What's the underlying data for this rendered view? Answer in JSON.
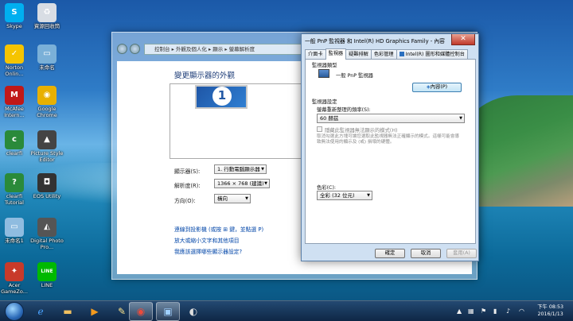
{
  "desktop": {
    "icons": [
      {
        "label": "Skype",
        "icon": "skype-icon",
        "color": "#00aff0",
        "glyph": "S"
      },
      {
        "label": "資源回收筒",
        "icon": "recycle-bin-icon",
        "color": "#d8dde4",
        "glyph": "♻"
      },
      {
        "label": "Norton Onlin...",
        "icon": "norton-icon",
        "color": "#f5c400",
        "glyph": "✓"
      },
      {
        "label": "未命名",
        "icon": "image-file-icon",
        "color": "#7ab0d8",
        "glyph": "▭"
      },
      {
        "label": "McAfee Intern...",
        "icon": "mcafee-icon",
        "color": "#c01818",
        "glyph": "M"
      },
      {
        "label": "Google Chrome",
        "icon": "chrome-icon",
        "color": "#e8b000",
        "glyph": "◉"
      },
      {
        "label": "clearfi",
        "icon": "clearfi-icon",
        "color": "#2a8a3a",
        "glyph": "c"
      },
      {
        "label": "Picture Style Editor",
        "icon": "picture-style-icon",
        "color": "#444",
        "glyph": "▲"
      },
      {
        "label": "clearfi Tutorial",
        "icon": "clearfi-tutorial-icon",
        "color": "#2a8a3a",
        "glyph": "?"
      },
      {
        "label": "EOS Utility",
        "icon": "camera-icon",
        "color": "#333",
        "glyph": "◘"
      },
      {
        "label": "未命名1",
        "icon": "image-file-icon-2",
        "color": "#8fbce0",
        "glyph": "▭"
      },
      {
        "label": "Digital Photo Pro...",
        "icon": "dpp-icon",
        "color": "#555",
        "glyph": "◭"
      },
      {
        "label": "Acer GameZo...",
        "icon": "acer-gamezone-icon",
        "color": "#c83a2a",
        "glyph": "✦"
      },
      {
        "label": "LINE",
        "icon": "line-icon",
        "color": "#00b900",
        "glyph": "LINE"
      }
    ]
  },
  "screen_res_window": {
    "address": "控制台 ▸ 外觀及個人化 ▸ 顯示 ▸ 螢幕解析度",
    "heading": "變更顯示器的外觀",
    "monitor_number": "1",
    "display_label": "顯示器(S):",
    "display_value": "1. 行動電腦顯示器",
    "resolution_label": "解析度(R):",
    "resolution_value": "1366 × 768 (建議)",
    "orientation_label": "方向(O):",
    "orientation_value": "橫向",
    "link_projector": "連線到投影機 (或按 ⊞ 鍵，並點選 P)",
    "link_text_size": "放大或縮小文字和其他項目",
    "link_help": "我應該選擇哪些顯示器設定?"
  },
  "properties_dialog": {
    "title": "一般 PnP 監視器 和 Intel(R) HD Graphics Family - 內容",
    "close": "✕",
    "tabs": [
      "介面卡",
      "監視器",
      "疑難排解",
      "色彩管理",
      "Intel(R) 圖形和媒體控制台"
    ],
    "active_tab": 1,
    "monitor_type_group": "監視器類型",
    "monitor_name": "一般 PnP 監視器",
    "properties_button": "內容(P)",
    "monitor_settings_group": "監視器設定",
    "refresh_label": "螢幕重新整理的頻率(S):",
    "refresh_value": "60 赫茲",
    "hide_modes": "隱藏此監視器無法顯示的模式(H)",
    "hide_modes_desc": "取消勾選此方塊可讓您選取此監視器無法正確顯示的模式。這樣可能會導致無法使用的顯示及 (或) 損壞的硬體。",
    "colors_label": "色彩(C):",
    "colors_value": "全彩 (32 位元)",
    "ok": "確定",
    "cancel": "取消",
    "apply": "套用(A)"
  },
  "taskbar": {
    "time": "下午 08:53",
    "date": "2016/1/13"
  }
}
